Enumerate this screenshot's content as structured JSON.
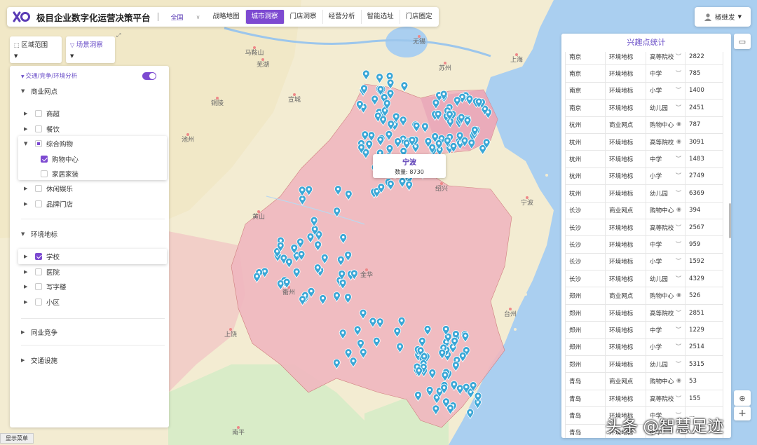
{
  "app": {
    "title": "极目企业数字化运营决策平台",
    "region": "全国"
  },
  "nav": {
    "tabs": [
      "战略地图",
      "城市洞察",
      "门店洞察",
      "经营分析",
      "智能选址",
      "门店圈定"
    ],
    "active": 1
  },
  "user": {
    "name": "椒继发"
  },
  "subtabs": {
    "region": "区域范围",
    "scene": "场景洞察"
  },
  "panel": {
    "header": "交通/竞争/环境分析",
    "groups": {
      "commerce": {
        "label": "商业网点",
        "items": [
          "商超",
          "餐饮",
          "综合购物",
          "休闲娱乐",
          "品牌门店"
        ],
        "sub": [
          "购物中心",
          "家居家装"
        ]
      },
      "environment": {
        "label": "环境地标",
        "items": [
          "学校",
          "医院",
          "写字楼",
          "小区"
        ]
      },
      "competition": {
        "label": "同业竞争"
      },
      "traffic": {
        "label": "交通设施"
      }
    }
  },
  "stats": {
    "title": "兴趣点统计",
    "rows": [
      [
        "南京",
        "环境地标",
        "高等院校",
        "2822"
      ],
      [
        "南京",
        "环境地标",
        "中学",
        "785"
      ],
      [
        "南京",
        "环境地标",
        "小学",
        "1400"
      ],
      [
        "南京",
        "环境地标",
        "幼儿园",
        "2451"
      ],
      [
        "杭州",
        "商业网点",
        "购物中心",
        "787"
      ],
      [
        "杭州",
        "环境地标",
        "高等院校",
        "3091"
      ],
      [
        "杭州",
        "环境地标",
        "中学",
        "1483"
      ],
      [
        "杭州",
        "环境地标",
        "小学",
        "2749"
      ],
      [
        "杭州",
        "环境地标",
        "幼儿园",
        "6369"
      ],
      [
        "长沙",
        "商业网点",
        "购物中心",
        "394"
      ],
      [
        "长沙",
        "环境地标",
        "高等院校",
        "2567"
      ],
      [
        "长沙",
        "环境地标",
        "中学",
        "959"
      ],
      [
        "长沙",
        "环境地标",
        "小学",
        "1592"
      ],
      [
        "长沙",
        "环境地标",
        "幼儿园",
        "4329"
      ],
      [
        "郑州",
        "商业网点",
        "购物中心",
        "526"
      ],
      [
        "郑州",
        "环境地标",
        "高等院校",
        "2851"
      ],
      [
        "郑州",
        "环境地标",
        "中学",
        "1229"
      ],
      [
        "郑州",
        "环境地标",
        "小学",
        "2514"
      ],
      [
        "郑州",
        "环境地标",
        "幼儿园",
        "5315"
      ],
      [
        "青岛",
        "商业网点",
        "购物中心",
        "53"
      ],
      [
        "青岛",
        "环境地标",
        "高等院校",
        "155"
      ],
      [
        "青岛",
        "环境地标",
        "中学",
        "..."
      ],
      [
        "青岛",
        "环境地标",
        "小学",
        "..."
      ]
    ]
  },
  "tooltip": {
    "title": "宁波",
    "count": "数量: 8730"
  },
  "map": {
    "cities": [
      "马鞍山",
      "无锡",
      "苏州",
      "上海",
      "芜湖",
      "铜陵",
      "宣城",
      "池州",
      "黄山",
      "绍兴",
      "宁波",
      "金华",
      "衢州",
      "上饶",
      "台州",
      "南平"
    ],
    "colors": {
      "land": "#f3ecd2",
      "region": "#f0b8c0",
      "sea": "#aacff0",
      "accent": "#7d4ad1",
      "marker": "#3ba7d6"
    }
  },
  "bottom": {
    "show_menu": "显示菜单"
  },
  "watermark": "头条 @智慧足迹"
}
